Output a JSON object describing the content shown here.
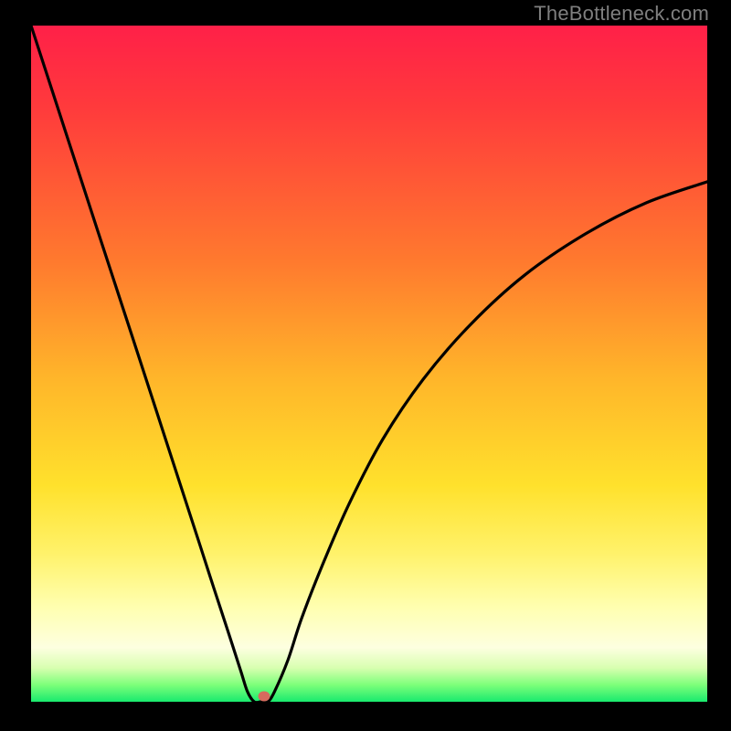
{
  "watermark": "TheBottleneck.com",
  "colors": {
    "background_frame": "#000000",
    "watermark_text": "#7f7f7f",
    "curve_stroke": "#000000",
    "marker_fill": "#d66a5e",
    "gradient_stops": [
      "#ff2048",
      "#ff3a3c",
      "#ff7a2e",
      "#ffb52a",
      "#ffe12c",
      "#fff26a",
      "#ffffb0",
      "#fdffe0",
      "#d8ffb0",
      "#7dff7a",
      "#19ea6e"
    ]
  },
  "chart_data": {
    "type": "line",
    "title": "",
    "xlabel": "",
    "ylabel": "",
    "xlim": [
      0,
      1
    ],
    "ylim": [
      0,
      1
    ],
    "grid": false,
    "series": [
      {
        "name": "bottleneck-curve",
        "x": [
          0.0,
          0.05,
          0.1,
          0.15,
          0.2,
          0.25,
          0.27,
          0.29,
          0.31,
          0.32,
          0.33,
          0.34,
          0.35,
          0.36,
          0.38,
          0.4,
          0.43,
          0.47,
          0.52,
          0.58,
          0.65,
          0.73,
          0.82,
          0.91,
          1.0
        ],
        "y": [
          1.0,
          0.846,
          0.692,
          0.539,
          0.385,
          0.231,
          0.169,
          0.108,
          0.046,
          0.015,
          0.0,
          0.0,
          0.0,
          0.015,
          0.062,
          0.123,
          0.2,
          0.292,
          0.388,
          0.477,
          0.558,
          0.631,
          0.692,
          0.738,
          0.769
        ]
      }
    ],
    "annotations": [
      {
        "name": "optimal-marker",
        "x": 0.345,
        "y": 0.008
      }
    ]
  }
}
